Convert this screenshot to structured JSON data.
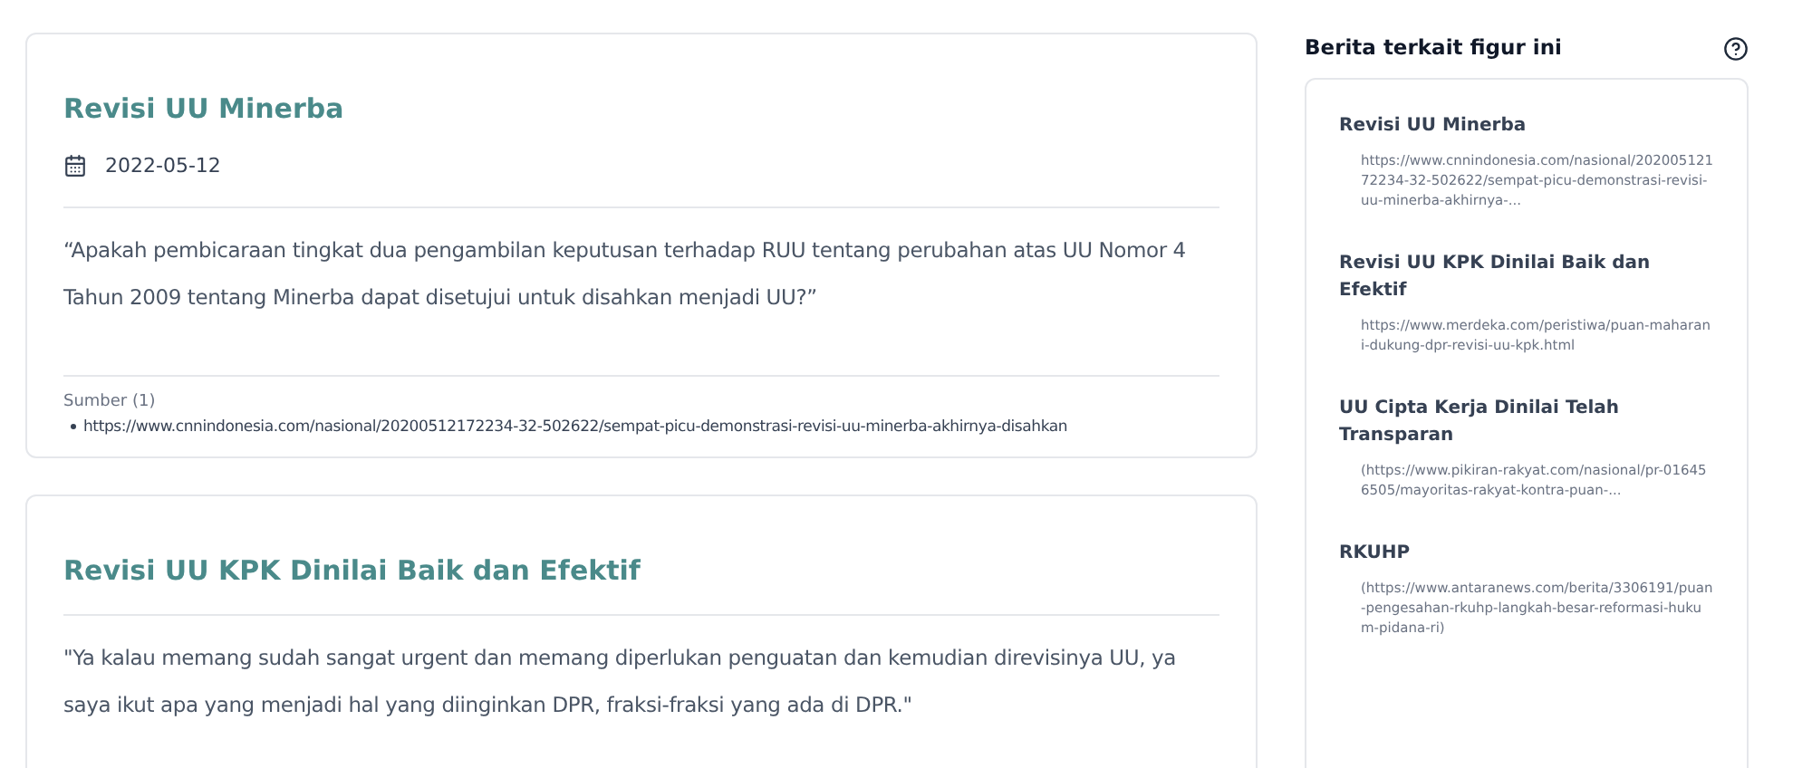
{
  "articles": [
    {
      "title": "Revisi UU Minerba",
      "date": "2022-05-12",
      "quote": "“Apakah pembicaraan tingkat dua pengambilan keputusan terhadap RUU tentang perubahan atas UU Nomor 4 Tahun 2009 tentang Minerba dapat disetujui untuk disahkan menjadi UU?”",
      "sources_label": "Sumber (1)",
      "sources": [
        "https://www.cnnindonesia.com/nasional/20200512172234-32-502622/sempat-picu-demonstrasi-revisi-uu-minerba-akhirnya-disahkan"
      ]
    },
    {
      "title": "Revisi UU KPK Dinilai Baik dan Efektif",
      "quote": "\"Ya kalau memang sudah sangat urgent dan memang diperlukan penguatan dan kemudian direvisinya UU, ya saya ikut apa yang menjadi hal yang diinginkan DPR, fraksi-fraksi yang ada di DPR.\""
    }
  ],
  "related": {
    "title": "Berita terkait figur ini",
    "items": [
      {
        "title": "Revisi UU Minerba",
        "url": "https://www.cnnindonesia.com/nasional/20200512172234-32-502622/sempat-picu-demonstrasi-revisi-uu-minerba-akhirnya-..."
      },
      {
        "title": "Revisi UU KPK Dinilai Baik dan Efektif",
        "url": "https://www.merdeka.com/peristiwa/puan-maharani-dukung-dpr-revisi-uu-kpk.html"
      },
      {
        "title": "UU Cipta Kerja Dinilai Telah Transparan",
        "url": "(https://www.pikiran-rakyat.com/nasional/pr-016456505/mayoritas-rakyat-kontra-puan-..."
      },
      {
        "title": "RKUHP",
        "url": "(https://www.antaranews.com/berita/3306191/puan-pengesahan-rkuhp-langkah-besar-reformasi-hukum-pidana-ri)"
      }
    ]
  }
}
